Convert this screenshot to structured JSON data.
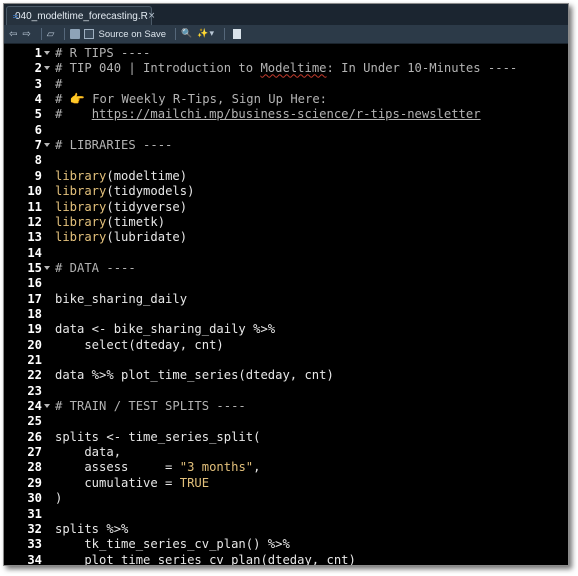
{
  "tab": {
    "filename": "040_modeltime_forecasting.R",
    "close": "×"
  },
  "toolbar": {
    "back_icon": "⇦",
    "forward_icon": "⇨",
    "show_in_window_icon": "▱",
    "save_icon": "save-icon",
    "source_on_save_label": "Source on Save",
    "search_icon": "🔍",
    "wand_icon": "✨",
    "dropdown_icon": "▾",
    "compile_icon": "compile-report-icon"
  },
  "editor": {
    "lines": [
      {
        "n": "1",
        "fold": true,
        "segments": [
          {
            "t": "# R TIPS ----",
            "c": "comment"
          }
        ]
      },
      {
        "n": "2",
        "fold": true,
        "segments": [
          {
            "t": "# TIP 040 | Introduction to ",
            "c": "comment"
          },
          {
            "t": "Modeltime",
            "c": "wave"
          },
          {
            "t": ": In Under 10-Minutes ----",
            "c": "comment"
          }
        ]
      },
      {
        "n": "3",
        "fold": false,
        "segments": [
          {
            "t": "#",
            "c": "comment"
          }
        ]
      },
      {
        "n": "4",
        "fold": false,
        "segments": [
          {
            "t": "# ",
            "c": "comment"
          },
          {
            "t": "👉",
            "c": "emoji"
          },
          {
            "t": " For Weekly R-Tips, Sign Up Here:",
            "c": "comment"
          }
        ]
      },
      {
        "n": "5",
        "fold": false,
        "segments": [
          {
            "t": "#    ",
            "c": "comment"
          },
          {
            "t": "https://mailchi.mp/business-science/r-tips-newsletter",
            "c": "link"
          }
        ]
      },
      {
        "n": "6",
        "fold": false,
        "segments": []
      },
      {
        "n": "7",
        "fold": true,
        "segments": [
          {
            "t": "# LIBRARIES ----",
            "c": "comment"
          }
        ]
      },
      {
        "n": "8",
        "fold": false,
        "segments": []
      },
      {
        "n": "9",
        "fold": false,
        "segments": [
          {
            "t": "library",
            "c": "fn"
          },
          {
            "t": "(modeltime)",
            "c": "plain"
          }
        ]
      },
      {
        "n": "10",
        "fold": false,
        "segments": [
          {
            "t": "library",
            "c": "fn"
          },
          {
            "t": "(tidymodels)",
            "c": "plain"
          }
        ]
      },
      {
        "n": "11",
        "fold": false,
        "segments": [
          {
            "t": "library",
            "c": "fn"
          },
          {
            "t": "(tidyverse)",
            "c": "plain"
          }
        ]
      },
      {
        "n": "12",
        "fold": false,
        "segments": [
          {
            "t": "library",
            "c": "fn"
          },
          {
            "t": "(timetk)",
            "c": "plain"
          }
        ]
      },
      {
        "n": "13",
        "fold": false,
        "segments": [
          {
            "t": "library",
            "c": "fn"
          },
          {
            "t": "(lubridate)",
            "c": "plain"
          }
        ]
      },
      {
        "n": "14",
        "fold": false,
        "segments": []
      },
      {
        "n": "15",
        "fold": true,
        "segments": [
          {
            "t": "# DATA ----",
            "c": "comment"
          }
        ]
      },
      {
        "n": "16",
        "fold": false,
        "segments": []
      },
      {
        "n": "17",
        "fold": false,
        "segments": [
          {
            "t": "bike_sharing_daily",
            "c": "plain"
          }
        ]
      },
      {
        "n": "18",
        "fold": false,
        "segments": []
      },
      {
        "n": "19",
        "fold": false,
        "segments": [
          {
            "t": "data <- bike_sharing_daily %>%",
            "c": "plain"
          }
        ]
      },
      {
        "n": "20",
        "fold": false,
        "segments": [
          {
            "t": "    select(dteday, cnt)",
            "c": "plain"
          }
        ]
      },
      {
        "n": "21",
        "fold": false,
        "segments": []
      },
      {
        "n": "22",
        "fold": false,
        "segments": [
          {
            "t": "data %>% plot_time_series(dteday, cnt)",
            "c": "plain"
          }
        ]
      },
      {
        "n": "23",
        "fold": false,
        "segments": []
      },
      {
        "n": "24",
        "fold": true,
        "segments": [
          {
            "t": "# TRAIN / TEST SPLITS ----",
            "c": "comment"
          }
        ]
      },
      {
        "n": "25",
        "fold": false,
        "segments": []
      },
      {
        "n": "26",
        "fold": false,
        "segments": [
          {
            "t": "splits <- time_series_split(",
            "c": "plain"
          }
        ]
      },
      {
        "n": "27",
        "fold": false,
        "segments": [
          {
            "t": "    data,",
            "c": "plain"
          }
        ]
      },
      {
        "n": "28",
        "fold": false,
        "segments": [
          {
            "t": "    assess     = ",
            "c": "plain"
          },
          {
            "t": "\"3 months\"",
            "c": "str"
          },
          {
            "t": ",",
            "c": "plain"
          }
        ]
      },
      {
        "n": "29",
        "fold": false,
        "segments": [
          {
            "t": "    cumulative = ",
            "c": "plain"
          },
          {
            "t": "TRUE",
            "c": "kw"
          }
        ]
      },
      {
        "n": "30",
        "fold": false,
        "segments": [
          {
            "t": ")",
            "c": "plain"
          }
        ]
      },
      {
        "n": "31",
        "fold": false,
        "segments": []
      },
      {
        "n": "32",
        "fold": false,
        "segments": [
          {
            "t": "splits %>%",
            "c": "plain"
          }
        ]
      },
      {
        "n": "33",
        "fold": false,
        "segments": [
          {
            "t": "    tk_time_series_cv_plan() %>%",
            "c": "plain"
          }
        ]
      },
      {
        "n": "34",
        "fold": false,
        "segments": [
          {
            "t": "    plot_time_series_cv_plan(dteday, cnt)",
            "c": "plain"
          }
        ]
      }
    ]
  }
}
